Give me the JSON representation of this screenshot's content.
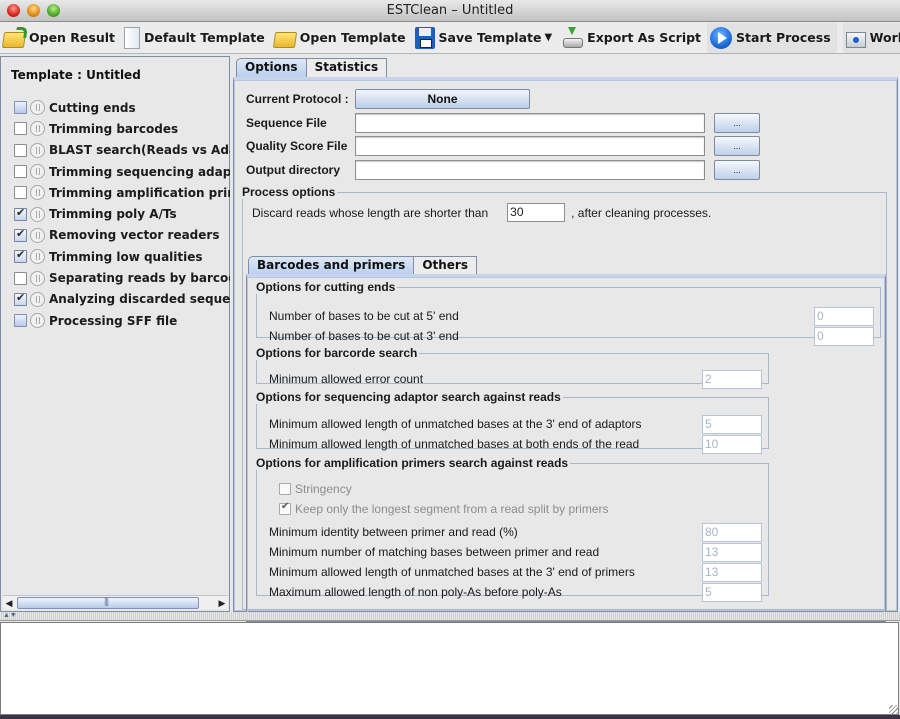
{
  "window": {
    "title": "ESTClean – Untitled"
  },
  "toolbar": {
    "open_result": "Open Result",
    "default_template": "Default Template",
    "open_template": "Open Template",
    "save_template": "Save Template",
    "save_template_caret": "▼",
    "export_as_script": "Export As Script",
    "start_process": "Start Process",
    "working_directory": "Working Directory"
  },
  "sidebar": {
    "header": "Template : Untitled",
    "steps": [
      {
        "label": "Cutting ends",
        "state": "partial"
      },
      {
        "label": "Trimming barcodes",
        "state": "unchecked"
      },
      {
        "label": "BLAST search(Reads vs Adaptors)",
        "state": "unchecked"
      },
      {
        "label": "Trimming sequencing adaptors",
        "state": "unchecked"
      },
      {
        "label": "Trimming amplification primers",
        "state": "unchecked"
      },
      {
        "label": "Trimming poly A/Ts",
        "state": "checked"
      },
      {
        "label": "Removing vector readers",
        "state": "checked"
      },
      {
        "label": "Trimming low qualities",
        "state": "checked"
      },
      {
        "label": "Separating reads by barcodes",
        "state": "unchecked"
      },
      {
        "label": "Analyzing discarded sequences",
        "state": "checked"
      },
      {
        "label": "Processing SFF file",
        "state": "partial"
      }
    ],
    "scroll_left": "◀",
    "scroll_right": "▶"
  },
  "main": {
    "tabs": [
      {
        "label": "Options",
        "active": true
      },
      {
        "label": "Statistics",
        "active": false
      }
    ],
    "current_protocol_label": "Current Protocol :",
    "current_protocol_value": "None",
    "sequence_file_label": "Sequence File",
    "sequence_file_value": "",
    "quality_score_file_label": "Quality Score File",
    "quality_score_file_value": "",
    "output_directory_label": "Output directory",
    "output_directory_value": "",
    "browse_label": "...",
    "process_options": {
      "legend": "Process options",
      "discard_prefix": "Discard reads whose length are shorter than",
      "discard_value": "30",
      "discard_suffix": ", after cleaning processes."
    },
    "subtabs": [
      {
        "label": "Barcodes and primers",
        "active": true
      },
      {
        "label": "Others",
        "active": false
      }
    ],
    "cutting_ends": {
      "legend": "Options for cutting ends",
      "rows": [
        {
          "label": "Number of bases to be cut at 5' end",
          "value": "0"
        },
        {
          "label": "Number of bases to be cut at 3' end",
          "value": "0"
        }
      ]
    },
    "barcode_search": {
      "legend": "Options for barcorde search",
      "rows": [
        {
          "label": "Minimum allowed error count",
          "value": "2"
        }
      ]
    },
    "adaptor_search": {
      "legend": "Options for sequencing adaptor search against reads",
      "rows": [
        {
          "label": "Minimum allowed length of unmatched bases at the 3' end of adaptors",
          "value": "5"
        },
        {
          "label": "Minimum allowed length of unmatched bases at both ends of the read",
          "value": "10"
        }
      ]
    },
    "primer_search": {
      "legend": "Options for amplification primers search against reads",
      "stringency_label": "Stringency",
      "stringency_checked": false,
      "keep_longest_label": "Keep only the longest segment from a read split by primers",
      "keep_longest_checked": true,
      "rows": [
        {
          "label": "Minimum identity between primer and read (%)",
          "value": "80"
        },
        {
          "label": "Minimum number of matching bases between primer and read",
          "value": "13"
        },
        {
          "label": "Minimum allowed length of unmatched bases at the 3' end of primers",
          "value": "13"
        },
        {
          "label": "Maximum allowed length of non poly-As before poly-As",
          "value": "5"
        }
      ]
    }
  },
  "console": {
    "text": ""
  }
}
